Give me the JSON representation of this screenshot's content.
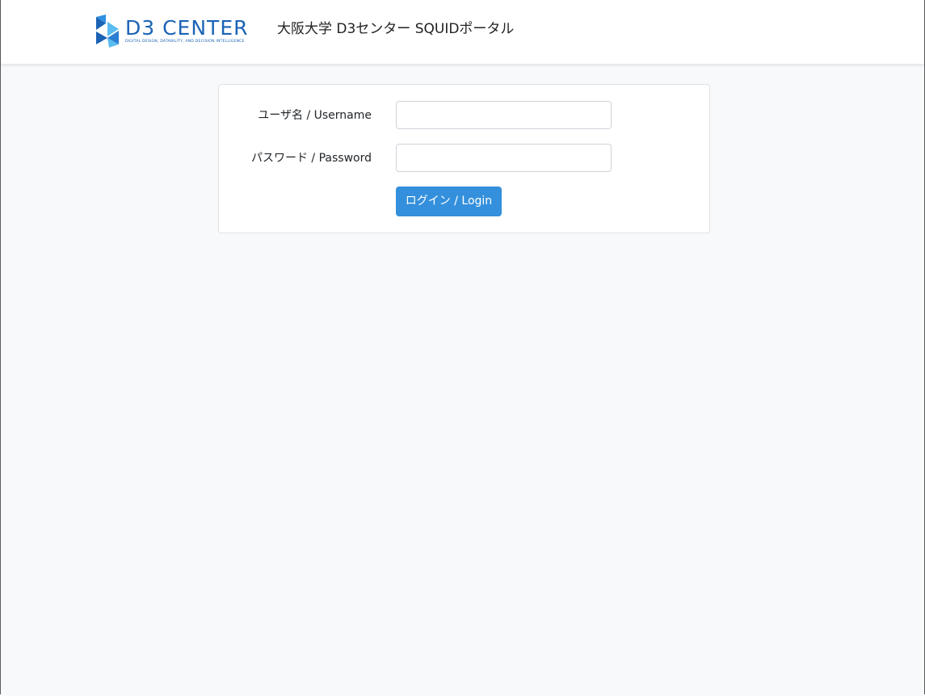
{
  "header": {
    "logo": {
      "title": "D3 CENTER",
      "tagline": "DIGITAL DESIGN, DATABILITY, AND DECISION INTELLIGENCE"
    },
    "site_title": "大阪大学 D3センター SQUIDポータル"
  },
  "login_form": {
    "username_label": "ユーザ名 / Username",
    "username_value": "",
    "password_label": "パスワード / Password",
    "password_value": "",
    "submit_label": "ログイン / Login"
  },
  "colors": {
    "accent": "#3490dc",
    "brand": "#1b63b5",
    "page_background": "#f8f9fb"
  },
  "icons": {
    "logo_mark": "d3-center-logo-icon"
  }
}
